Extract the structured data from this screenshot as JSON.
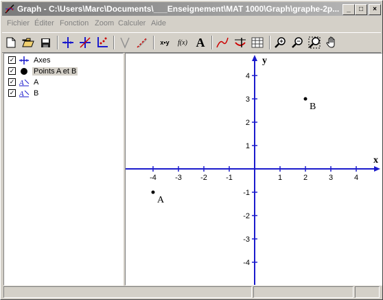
{
  "window": {
    "title": "Graph - C:\\Users\\Marc\\Documents\\___Enseignement\\MAT 1000\\Graph\\graphe-2p...",
    "controls": [
      "_",
      "□",
      "×"
    ]
  },
  "menu": [
    "Fichier",
    "Éditer",
    "Fonction",
    "Zoom",
    "Calculer",
    "Aide"
  ],
  "toolbar": {
    "icons": [
      "new-file-icon",
      "open-folder-icon",
      "save-icon",
      "axes-icon",
      "insert-series-icon",
      "point-series-icon",
      "tangent-icon",
      "normal-icon",
      "xy-icon",
      "function-icon",
      "text-icon",
      "trendline-icon",
      "relation-icon",
      "table-icon",
      "zoom-in-icon",
      "zoom-out-icon",
      "zoom-fit-icon",
      "pan-hand-icon"
    ],
    "labels": {
      "xy": "x•y",
      "fx": "f(x)",
      "text": "A"
    }
  },
  "items": [
    {
      "label": "Axes",
      "checked": true,
      "icon": "axes-icon",
      "selected": false
    },
    {
      "label": "Points A et B",
      "checked": true,
      "icon": "point-marker-icon",
      "selected": true
    },
    {
      "label": "A",
      "checked": true,
      "icon": "label-icon",
      "selected": false
    },
    {
      "label": "B",
      "checked": true,
      "icon": "label-icon",
      "selected": false
    }
  ],
  "graph": {
    "x_axis_label": "x",
    "y_axis_label": "y",
    "x_ticks": [
      "-4",
      "-3",
      "-2",
      "-1",
      "1",
      "2",
      "3",
      "4"
    ],
    "y_ticks": [
      "4",
      "3",
      "2",
      "1",
      "-1",
      "-2",
      "-3",
      "-4"
    ],
    "points": [
      {
        "label": "A",
        "x": -4,
        "y": -1
      },
      {
        "label": "B",
        "x": 2,
        "y": 3
      }
    ],
    "axis_color": "#1a1acc"
  }
}
